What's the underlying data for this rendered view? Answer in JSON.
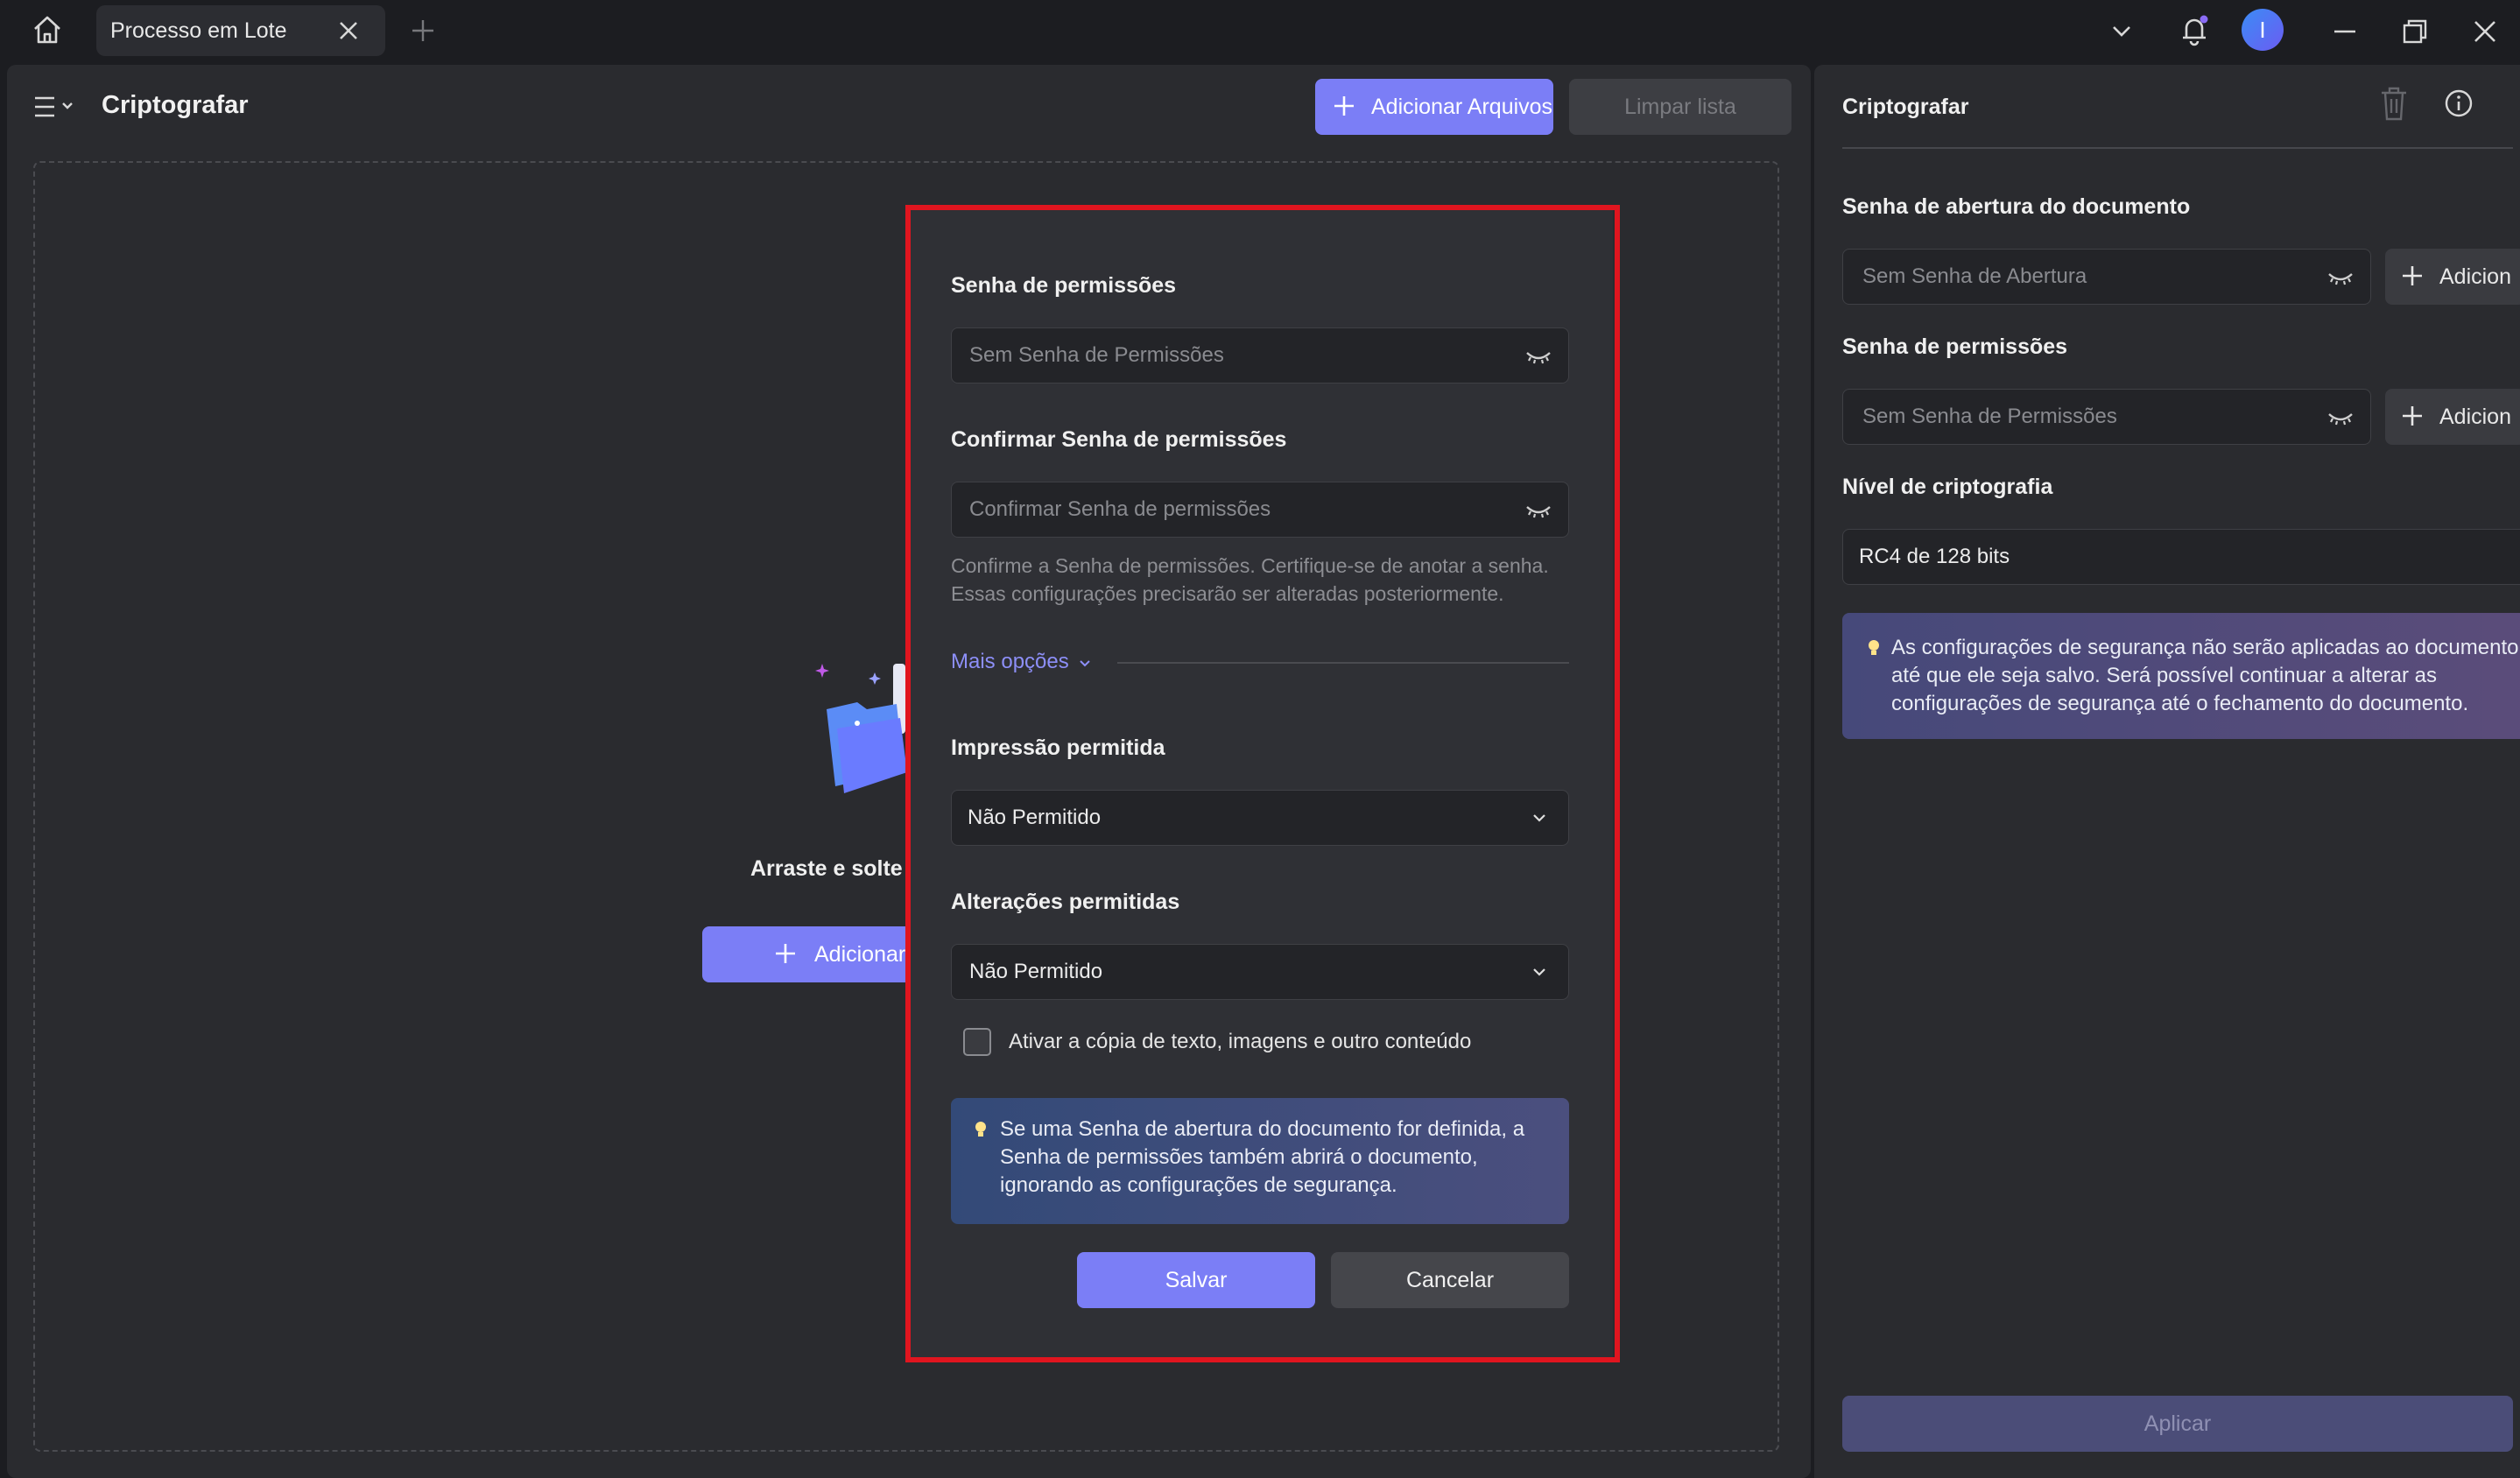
{
  "titlebar": {
    "tab_label": "Processo em Lote",
    "avatar_initial": "I"
  },
  "toolbar": {
    "title": "Criptografar",
    "add_files_label": "Adicionar Arquivos",
    "clear_list_label": "Limpar lista"
  },
  "dropzone": {
    "drag_text": "Arraste e solte c",
    "add_button_label": "Adicionar"
  },
  "dialog": {
    "permissions_label": "Senha de permissões",
    "permissions_placeholder": "Sem Senha de Permissões",
    "confirm_label": "Confirmar Senha de permissões",
    "confirm_placeholder": "Confirmar Senha de permissões",
    "hint_line1": "Confirme a Senha de permissões. Certifique-se de anotar a senha.",
    "hint_line2": "Essas configurações precisarão ser alteradas posteriormente.",
    "more_options": "Mais opções",
    "printing_label": "Impressão permitida",
    "printing_value": "Não Permitido",
    "changes_label": "Alterações permitidas",
    "changes_value": "Não Permitido",
    "copy_checkbox_label": "Ativar a cópia de texto, imagens e outro conteúdo",
    "info_line1": "Se uma Senha de abertura do documento for definida, a",
    "info_line2": "Senha de permissões também abrirá o documento,",
    "info_line3": "ignorando as configurações de segurança.",
    "save_label": "Salvar",
    "cancel_label": "Cancelar"
  },
  "side_panel": {
    "title": "Criptografar",
    "open_password_label": "Senha de abertura do documento",
    "open_password_placeholder": "Sem Senha de Abertura",
    "add_button_label": "Adicion",
    "permissions_label": "Senha de permissões",
    "permissions_placeholder": "Sem Senha de Permissões",
    "encryption_label": "Nível de criptografia",
    "encryption_value": "RC4 de 128 bits",
    "info_line1": "As configurações de segurança não serão aplicadas ao documento",
    "info_line2": "até que ele seja salvo. Será possível continuar a alterar as",
    "info_line3": "configurações de segurança até o fechamento do documento.",
    "apply_label": "Aplicar"
  },
  "colors": {
    "accent": "#7b7ef6",
    "highlight_border": "#e0151f",
    "background": "#1c1d21",
    "panel": "#2a2b2f"
  }
}
